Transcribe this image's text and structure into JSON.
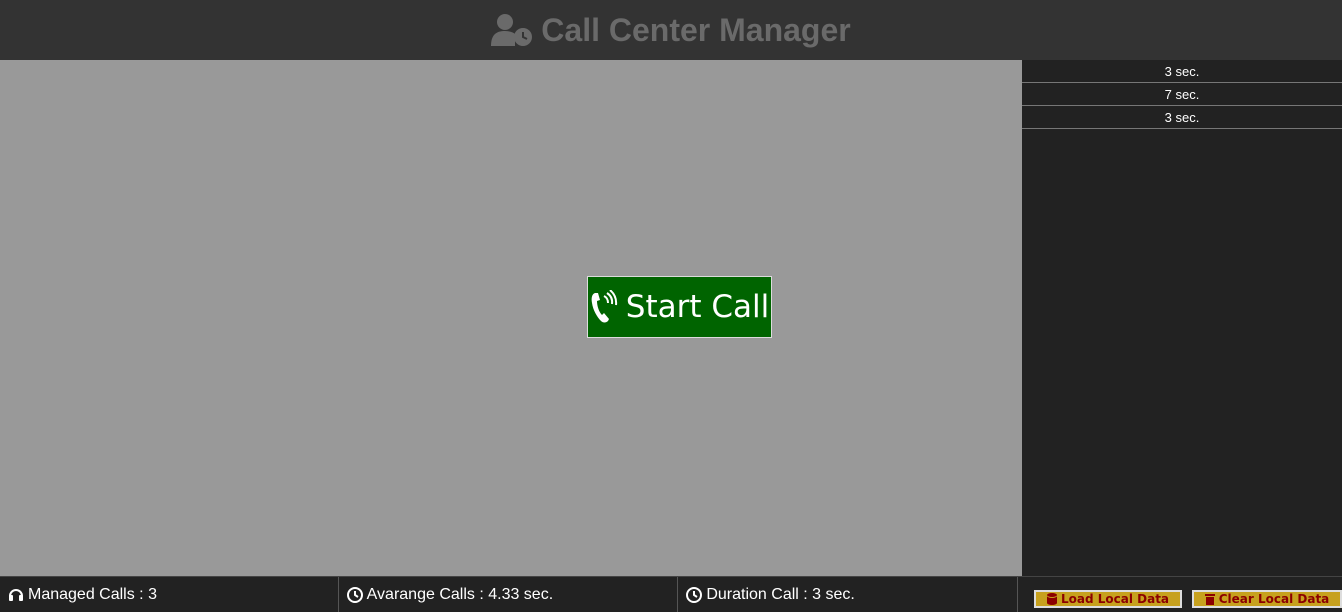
{
  "header": {
    "title": "Call Center Manager",
    "icon": "user-clock-icon"
  },
  "main": {
    "start_button": {
      "label": "Start Call",
      "icon": "phone-volume-icon"
    }
  },
  "sidebar": {
    "log": [
      "3 sec.",
      "7 sec.",
      "3 sec."
    ]
  },
  "footer": {
    "managed": {
      "label": "Managed Calls : 3",
      "icon": "headset-icon"
    },
    "average": {
      "label": "Avarange Calls : 4.33 sec.",
      "icon": "clock-icon"
    },
    "duration": {
      "label": "Duration Call : 3 sec.",
      "icon": "clock-icon"
    },
    "load_button": {
      "label": "Load Local Data",
      "icon": "database-icon"
    },
    "clear_button": {
      "label": "Clear Local Data",
      "icon": "trash-icon"
    }
  },
  "colors": {
    "header_bg": "#333333",
    "main_bg": "#999999",
    "button_green": "#006400",
    "sidebar_bg": "#222222",
    "action_gold": "#c7a11e",
    "action_text": "#8b0000"
  }
}
